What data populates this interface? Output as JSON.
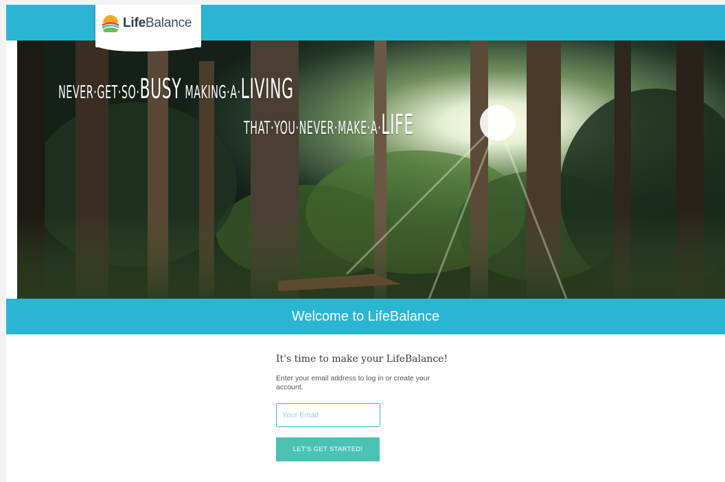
{
  "brand": {
    "name_bold": "Life",
    "name_rest": "Balance",
    "logo_icon": "sun-over-hills-icon",
    "bar_color": "#2ab5d3",
    "button_color": "#4cc2b5"
  },
  "hero": {
    "line1_a": "Never·get·so·",
    "line1_b": "Busy",
    "line1_c": " making·a·",
    "line1_d": "Living",
    "line2_a": "that·you·never·make·a·",
    "line2_b": "Life"
  },
  "welcome": {
    "title": "Welcome to LifeBalance"
  },
  "form": {
    "heading": "It's time to make your LifeBalance!",
    "description": "Enter your email address to log in or create your account.",
    "email_placeholder": "Your Email",
    "submit_label": "LET'S GET STARTED!"
  }
}
